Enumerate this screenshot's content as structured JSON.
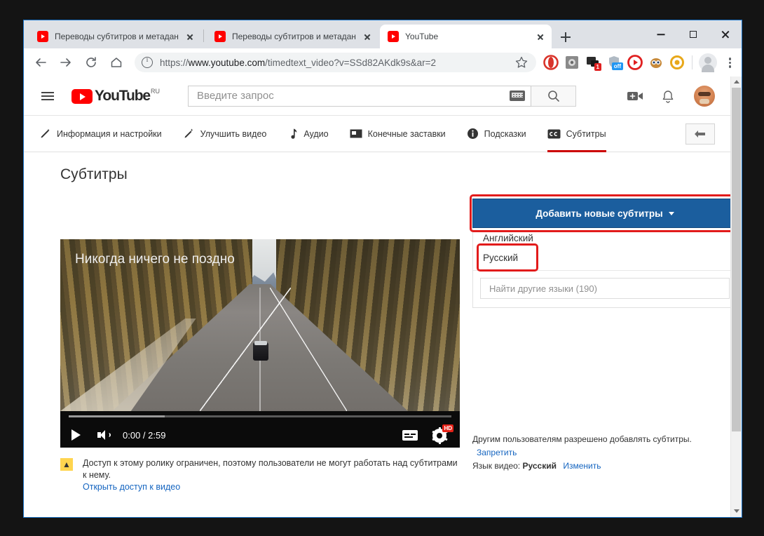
{
  "window": {
    "controls": {
      "minimize": "—",
      "maximize": "□",
      "close": "✕"
    }
  },
  "browser": {
    "tabs": [
      {
        "title": "Переводы субтитров и метадан",
        "favicon": "youtube-icon",
        "active": false
      },
      {
        "title": "Переводы субтитров и метадан",
        "favicon": "youtube-icon",
        "active": false
      },
      {
        "title": "YouTube",
        "favicon": "youtube-icon",
        "active": true
      }
    ],
    "new_tab_label": "+",
    "toolbar": {
      "back_label": "←",
      "forward_label": "→",
      "reload_label": "⟳",
      "home_label": "⌂",
      "url_scheme": "https://",
      "url_domain": "www.youtube.com",
      "url_path": "/timedtext_video?v=SSd82AKdk9s&ar=2",
      "url_full": "https://www.youtube.com/timedtext_video?v=SSd82AKdk9s&ar=2",
      "bookmark_label": "☆",
      "extensions": [
        {
          "name": "opera-touch-icon",
          "color": "#d9342b"
        },
        {
          "name": "puzzle-extension-icon",
          "color": "#757575"
        },
        {
          "name": "screenshot-extension-icon",
          "color": "#2b2b2b",
          "badge": "1"
        },
        {
          "name": "adguard-off-icon",
          "color": "#9aa5b1",
          "badge": "off"
        },
        {
          "name": "video-downloader-icon",
          "color": "#e02020"
        },
        {
          "name": "owl-extension-icon",
          "color": "#c78a3b"
        },
        {
          "name": "ring-extension-icon",
          "color": "#e8a81a"
        }
      ],
      "profile_label": "profile",
      "menu_label": "⋮"
    }
  },
  "youtube": {
    "menu_label": "Меню",
    "logo_text": "YouTube",
    "logo_locale": "RU",
    "search": {
      "placeholder": "Введите запрос",
      "value": "",
      "keyboard_icon": "keyboard-icon",
      "search_icon": "search-icon"
    },
    "actions": {
      "upload": "video-upload-icon",
      "notifications": "bell-icon",
      "avatar": "avatar"
    }
  },
  "editor_tabs": [
    {
      "label": "Информация и настройки",
      "icon": "pencil-icon",
      "active": false
    },
    {
      "label": "Улучшить видео",
      "icon": "magic-wand-icon",
      "active": false
    },
    {
      "label": "Аудио",
      "icon": "music-note-icon",
      "active": false
    },
    {
      "label": "Конечные заставки",
      "icon": "end-screen-icon",
      "active": false
    },
    {
      "label": "Подсказки",
      "icon": "info-icon",
      "active": false
    },
    {
      "label": "Субтитры",
      "icon": "cc-icon",
      "active": true
    }
  ],
  "back_button_label": "back-arrow",
  "page": {
    "title": "Субтитры"
  },
  "player": {
    "video_title": "Никогда ничего не поздно",
    "current_time": "0:00",
    "duration": "2:59",
    "time_display": "0:00 / 2:59",
    "play_label": "Воспроизвести",
    "volume_label": "Звук",
    "subtitles_label": "Субтитры",
    "settings_label": "Настройки",
    "quality_badge": "HD",
    "progress_percent": 25
  },
  "warning": {
    "icon": "warning-triangle-icon",
    "text": "Доступ к этому ролику ограничен, поэтому пользователи не могут работать над субтитрами к нему.",
    "link": "Открыть доступ к видео"
  },
  "subtitles_panel": {
    "add_button": "Добавить новые субтитры",
    "add_button_caret": "▾",
    "languages": [
      {
        "label": "Английский",
        "highlighted": false
      },
      {
        "label": "Русский",
        "highlighted": true
      }
    ],
    "search_placeholder": "Найти другие языки (190)"
  },
  "permissions": {
    "line1_text": "Другим пользователям разрешено добавлять субтитры.",
    "line1_link": "Запретить",
    "line2_prefix": "Язык видео:",
    "line2_value": "Русский",
    "line2_link": "Изменить"
  },
  "annotations": {
    "highlight_color": "#e21b1b",
    "boxes": [
      {
        "name": "add-subtitles-button-highlight"
      },
      {
        "name": "russian-language-highlight"
      }
    ]
  },
  "colors": {
    "accent_blue": "#1b5e9e",
    "youtube_red": "#ff0000",
    "link_blue": "#1565c0",
    "tab_active_underline": "#cc0000"
  }
}
